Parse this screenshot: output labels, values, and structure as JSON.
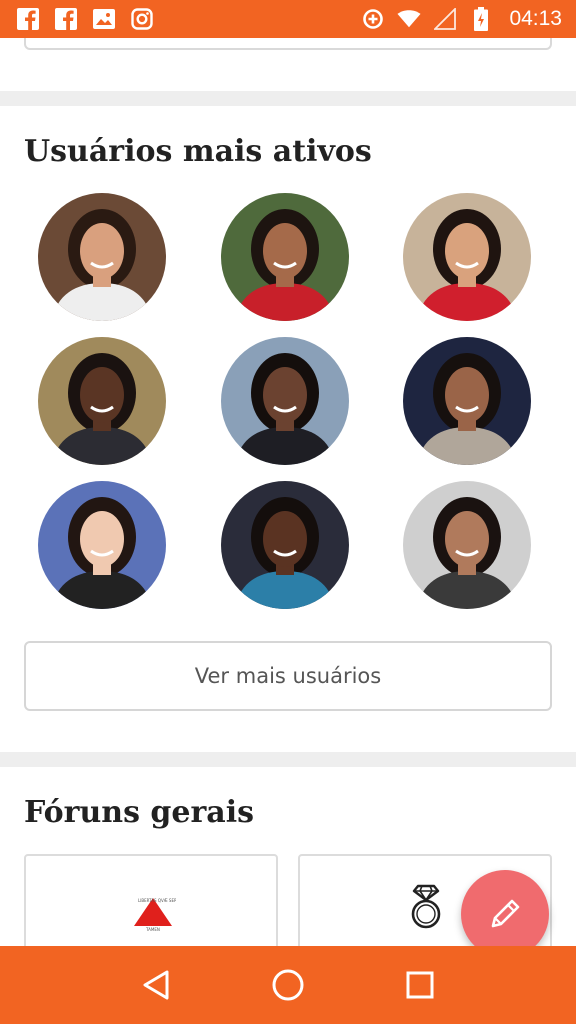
{
  "status_bar": {
    "time": "04:13",
    "left_icons": [
      "facebook-icon",
      "facebook-icon",
      "gallery-icon",
      "instagram-icon"
    ],
    "right_icons": [
      "data-saver-icon",
      "wifi-icon",
      "signal-icon",
      "battery-charging-icon"
    ]
  },
  "users_section": {
    "title": "Usuários mais ativos",
    "more_button": "Ver mais usuários",
    "avatars": [
      {
        "name": "avatar-1",
        "bg": "#6b4a36",
        "skin": "#d9a07e",
        "hair": "#2a1a12",
        "shirt": "#eeeeee"
      },
      {
        "name": "avatar-2",
        "bg": "#4f6a3c",
        "skin": "#a56a4a",
        "hair": "#1d1410",
        "shirt": "#c8202a"
      },
      {
        "name": "avatar-3",
        "bg": "#c7b39a",
        "skin": "#d9a27d",
        "hair": "#1f1410",
        "shirt": "#d01f2d"
      },
      {
        "name": "avatar-4",
        "bg": "#a08a5c",
        "skin": "#5a3524",
        "hair": "#1a1210",
        "shirt": "#2c2c33"
      },
      {
        "name": "avatar-5",
        "bg": "#8aa0b8",
        "skin": "#6b4230",
        "hair": "#140e0c",
        "shirt": "#1e1e24"
      },
      {
        "name": "avatar-6",
        "bg": "#1e2540",
        "skin": "#9a6448",
        "hair": "#16100e",
        "shirt": "#b0a69a"
      },
      {
        "name": "avatar-7",
        "bg": "#5b72b8",
        "skin": "#f0c9b0",
        "hair": "#221612",
        "shirt": "#222222"
      },
      {
        "name": "avatar-8",
        "bg": "#2a2c3a",
        "skin": "#5a3322",
        "hair": "#140e0c",
        "shirt": "#2c7fa8"
      },
      {
        "name": "avatar-9",
        "bg": "#cfcfcf",
        "skin": "#b07a5c",
        "hair": "#1a1210",
        "shirt": "#3a3a3a"
      }
    ]
  },
  "forums_section": {
    "title": "Fóruns gerais",
    "cards": [
      {
        "name": "forum-card-1",
        "icon": "state-flag-icon",
        "peek_text": ""
      },
      {
        "name": "forum-card-2",
        "icon": "ring-icon",
        "peek_text": ""
      }
    ]
  },
  "fab": {
    "icon": "pencil-icon"
  },
  "nav_bar": {
    "buttons": [
      "back-icon",
      "home-icon",
      "recents-icon"
    ]
  },
  "colors": {
    "accent": "#f26422",
    "fab": "#f06b6e",
    "divider": "#eeeeee"
  }
}
